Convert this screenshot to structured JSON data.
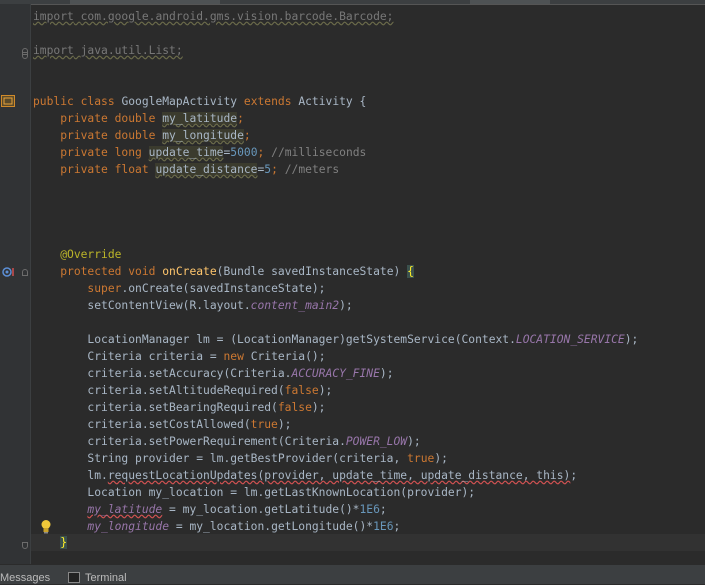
{
  "editor": {
    "lines": {
      "l1": {
        "import_kw": "import",
        "path": "com.google.android.gms.vision.barcode.Barcode;"
      },
      "l2": {
        "import_kw": "import",
        "path": "java.util.List;"
      },
      "class_decl": {
        "public_kw": "public",
        "class_kw": "class",
        "name": "GoogleMapActivity",
        "extends_kw": "extends",
        "base": "Activity",
        "brace": "{"
      },
      "field1": {
        "mods": "private double",
        "name": "my_latitude",
        "end": ";"
      },
      "field2": {
        "mods": "private double",
        "name": "my_longitude",
        "end": ";"
      },
      "field3": {
        "mods": "private long",
        "name": "update_time",
        "eq": "=",
        "num": "5000",
        "end": ";",
        "comment": "//milliseconds"
      },
      "field4": {
        "mods": "private float",
        "name": "update_distance",
        "eq": "=",
        "num": "5",
        "end": ";",
        "comment": "//meters"
      },
      "annotation": "@Override",
      "method_decl": {
        "mods": "protected void",
        "name": "onCreate",
        "params": "(Bundle savedInstanceState)",
        "brace": "{"
      },
      "super_call": {
        "kw": "super",
        "rest": ".onCreate(savedInstanceState);"
      },
      "set_content": {
        "pre": "setContentView(R.layout.",
        "ital": "content_main2",
        "post": ");"
      },
      "lm_decl": {
        "pre": "LocationManager lm = (LocationManager)getSystemService(Context.",
        "const": "LOCATION_SERVICE",
        "post": ");"
      },
      "criteria_decl": {
        "pre": "Criteria criteria =",
        "kw": "new",
        "post": "Criteria();"
      },
      "set_accuracy": {
        "pre": "criteria.setAccuracy(Criteria.",
        "const": "ACCURACY_FINE",
        "post": ");"
      },
      "set_altitude": {
        "pre": "criteria.setAltitudeRequired(",
        "kw": "false",
        "post": ");"
      },
      "set_bearing": {
        "pre": "criteria.setBearingRequired(",
        "kw": "false",
        "post": ");"
      },
      "set_cost": {
        "pre": "criteria.setCostAllowed(",
        "kw": "true",
        "post": ");"
      },
      "set_power": {
        "pre": "criteria.setPowerRequirement(Criteria.",
        "const": "POWER_LOW",
        "post": ");"
      },
      "provider_decl": {
        "pre": "String provider = lm.getBestProvider(criteria,",
        "kw": "true",
        "post": ");"
      },
      "request_updates": {
        "pre": "lm.",
        "err": "requestLocationUpdates(provider, update_time, update_distance, this)",
        "post": ";"
      },
      "location_decl": "Location my_location = lm.getLastKnownLocation(provider);",
      "lat_assign": {
        "field": "my_latitude",
        "pre": " = my_location.getLatitude()*",
        "num": "1E6",
        "post": ";"
      },
      "lon_assign": {
        "field": "my_longitude",
        "pre": " = my_location.getLongitude()*",
        "num": "1E6",
        "post": ";"
      },
      "closing": "}"
    }
  },
  "bottom_bar": {
    "messages_label": "Messages",
    "terminal_label": "Terminal"
  },
  "colors": {
    "background": "#2b2b2b",
    "keyword": "#cc7832",
    "number": "#6897bb",
    "comment": "#808080",
    "annotation": "#bbb529",
    "constant": "#9876aa"
  },
  "icons": {
    "class_marker": "class-gutter-icon",
    "override_marker": "override-gutter-icon",
    "intention": "lightbulb-icon"
  }
}
